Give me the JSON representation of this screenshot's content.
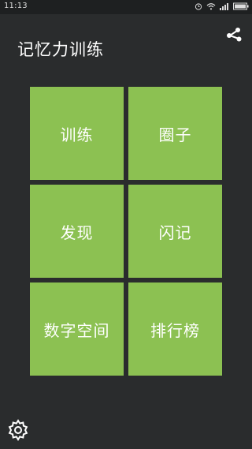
{
  "status_bar": {
    "time": "11:13",
    "icons": [
      "alarm-icon",
      "wifi-icon",
      "signal-icon",
      "battery-icon"
    ]
  },
  "header": {
    "title": "记忆力训练",
    "share_icon": "share-icon"
  },
  "menu": {
    "tiles": [
      {
        "label": "训练"
      },
      {
        "label": "圈子"
      },
      {
        "label": "发现"
      },
      {
        "label": "闪记"
      },
      {
        "label": "数字空间"
      },
      {
        "label": "排行榜"
      }
    ]
  },
  "footer": {
    "settings_icon": "gear-icon"
  },
  "colors": {
    "background": "#2a2c2d",
    "tile": "#8cc152",
    "text": "#ffffff"
  }
}
